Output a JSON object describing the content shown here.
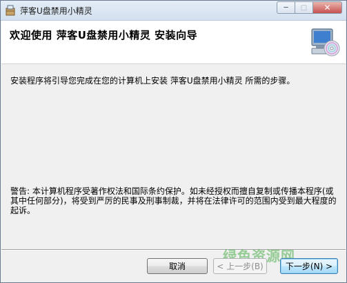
{
  "window": {
    "title": "萍客U盘禁用小精灵",
    "icon": "installer-box-icon",
    "controls": {
      "minimize": "─",
      "maximize": "□",
      "close": "✕"
    }
  },
  "header": {
    "title": "欢迎使用  萍客U盘禁用小精灵  安装向导",
    "icon": "computer-cd-icon"
  },
  "intro_text": "安装程序将引导您完成在您的计算机上安装  萍客U盘禁用小精灵 所需的步骤。",
  "warning_text": "警告: 本计算机程序受著作权法和国际条约保护。如未经授权而擅自复制或传播本程序(或其中任何部分)，将受到严厉的民事及刑事制裁，并将在法律许可的范围内受到最大程度的起诉。",
  "buttons": {
    "cancel": "取消",
    "back": "< 上一步(B)",
    "next": "下一步(N) >"
  },
  "watermark": "绿色资源网"
}
